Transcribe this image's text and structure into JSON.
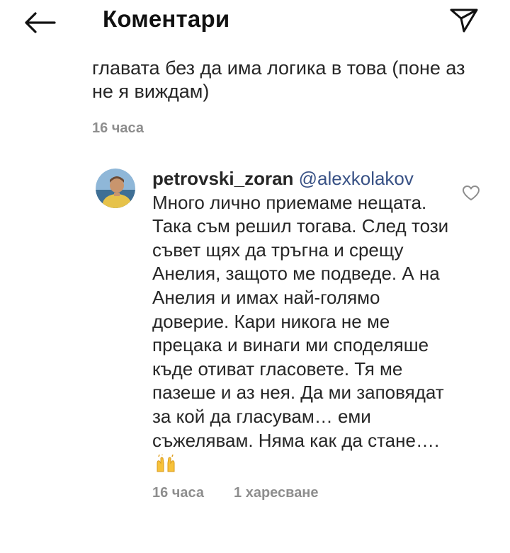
{
  "header": {
    "title": "Коментари",
    "back_icon": "arrow-left-icon",
    "send_icon": "paper-plane-icon"
  },
  "previous_comment": {
    "text": "главата без да има логика в това (поне аз не я виждам)",
    "time": "16 часа"
  },
  "comment": {
    "username": "petrovski_zoran",
    "mention": "@alexkolakov",
    "text": "Много лично приемаме нещата. Така съм решил тогава. След този съвет щях да тръгна и срещу Анелия, защото ме подведе. А на Анелия и имах най-голямо доверие. Кари никога не ме прецака и винаги ми споделяше къде отиват гласовете. Тя ме пазеше и аз нея. Да ми заповядат за кой да гласувам… еми съжелявам. Няма как да стане….",
    "emoji": "raising-hands-emoji",
    "time": "16 часа",
    "likes": "1 харесване",
    "like_icon": "heart-outline-icon"
  },
  "colors": {
    "text": "#262626",
    "meta": "#8e8e8e",
    "mention": "#385185",
    "background": "#ffffff"
  }
}
